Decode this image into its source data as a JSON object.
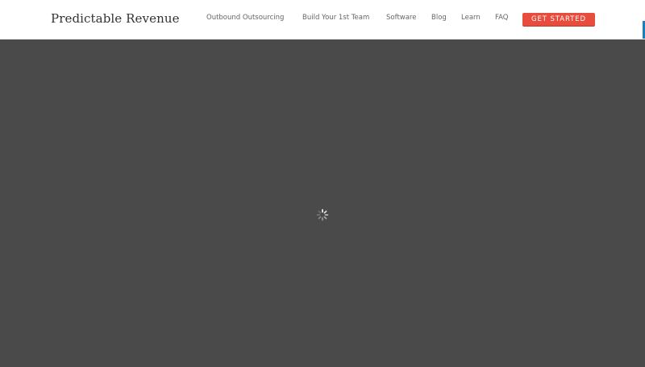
{
  "header": {
    "logo_text": "Predictable Revenue",
    "nav": [
      {
        "label": "Outbound Outsourcing"
      },
      {
        "label": "Build Your 1st Team"
      },
      {
        "label": "Software"
      },
      {
        "label": "Blog"
      },
      {
        "label": "Learn"
      },
      {
        "label": "FAQ"
      }
    ],
    "cta_label": "GET STARTED"
  },
  "colors": {
    "overlay": "#4a4a4a",
    "cta": "#e84c3d",
    "edge_tab": "#1a7fc1"
  },
  "icons": {
    "loading": "spinner-icon"
  }
}
